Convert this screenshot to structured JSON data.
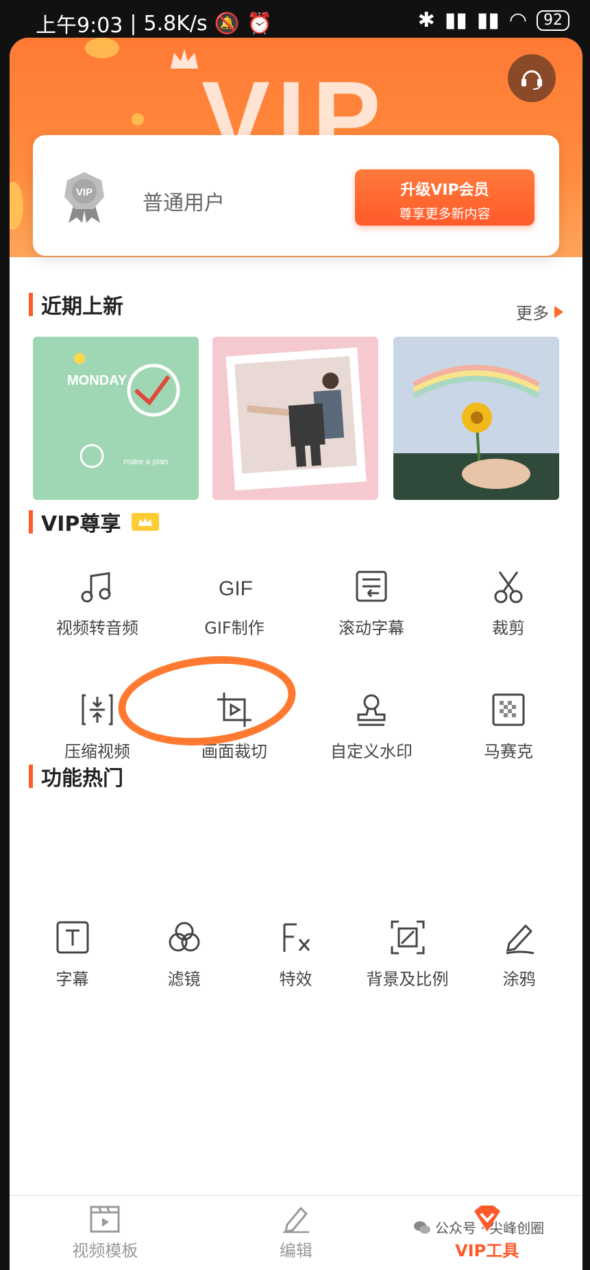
{
  "status": {
    "time": "上午9:03",
    "speed": "5.8K/s",
    "battery": "92"
  },
  "hero": {
    "bg_text": "VIP"
  },
  "card": {
    "user_label": "普通用户",
    "upgrade_line1": "升级VIP会员",
    "upgrade_line2": "尊享更多新内容"
  },
  "recent": {
    "title": "近期上新",
    "more": "更多"
  },
  "vip": {
    "title": "VIP尊享",
    "items": [
      "视频转音频",
      "GIF制作",
      "滚动字幕",
      "裁剪",
      "压缩视频",
      "画面裁切",
      "自定义水印",
      "马赛克"
    ]
  },
  "hot": {
    "title": "功能热门",
    "items": [
      "字幕",
      "滤镜",
      "特效",
      "背景及比例",
      "涂鸦"
    ]
  },
  "tabs": [
    "视频模板",
    "编辑",
    "VIP工具"
  ],
  "watermark": "公众号 · 尖峰创圈",
  "colors": {
    "accent": "#ff5a2a",
    "hero": "#ff7a35"
  }
}
